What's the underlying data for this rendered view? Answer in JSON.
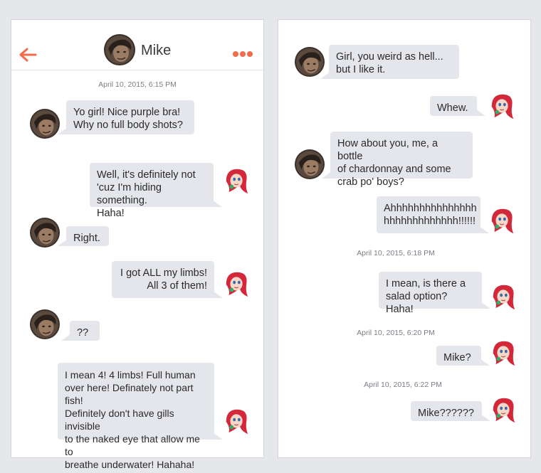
{
  "colors": {
    "accent": "#f26b4a",
    "bubble": "#e5e6eb",
    "background": "#e6e7eb",
    "avatar_mike": "#3b2f2a",
    "avatar_ariel_hair": "#d3283a",
    "avatar_ariel_skin": "#f6d7c8"
  },
  "icons": {
    "back": "left-arrow-icon",
    "more": "three-dots-icon"
  },
  "chat": {
    "contact_name": "Mike"
  },
  "left_screen": {
    "timestamp_1": "April 10, 2015, 6:15 PM",
    "messages": [
      {
        "sender": "Mike",
        "text": "Yo girl! Nice purple bra!\n Why no full body shots?"
      },
      {
        "sender": "me",
        "text": "Well, it's definitely not\n'cuz I'm hiding something.\nHaha!"
      },
      {
        "sender": "Mike",
        "text": "Right."
      },
      {
        "sender": "me",
        "text": "I got ALL my limbs!\nAll 3 of them!"
      },
      {
        "sender": "Mike",
        "text": "??"
      },
      {
        "sender": "me",
        "text": "I mean 4! 4 limbs! Full human\nover here! Definately not part fish!\nDefinitely don't have gills invisible\nto the naked eye that allow me to\nbreathe underwater! Hahaha!"
      }
    ]
  },
  "right_screen": {
    "messages": [
      {
        "sender": "Mike",
        "text": "Girl, you weird as hell...\nbut I like it."
      },
      {
        "sender": "me",
        "text": "Whew."
      },
      {
        "sender": "Mike",
        "text": "How about you, me, a bottle\nof chardonnay and some\ncrab po' boys?"
      },
      {
        "sender": "me",
        "text": "Ahhhhhhhhhhhhhhh\nhhhhhhhhhhhhh!!!!!!"
      },
      {
        "sender": "me",
        "text": "I mean, is there a\nsalad option? Haha!"
      },
      {
        "sender": "me",
        "text": "Mike?"
      },
      {
        "sender": "me",
        "text": "Mike??????"
      }
    ],
    "timestamp_1": "April 10, 2015, 6:18 PM",
    "timestamp_2": "April 10, 2015, 6:20 PM",
    "timestamp_3": "April 10, 2015, 6:22 PM"
  }
}
